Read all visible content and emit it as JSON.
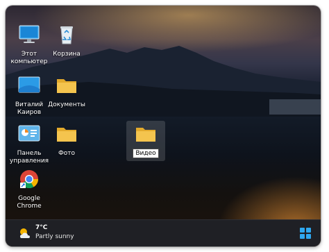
{
  "desktop": {
    "icons": [
      {
        "label": "Этот компьютер",
        "icon": "computer-monitor-icon"
      },
      {
        "label": "Корзина",
        "icon": "recycle-bin-icon"
      },
      {
        "label": "Виталий Каиров",
        "icon": "user-folder-icon"
      },
      {
        "label": "Документы",
        "icon": "folder-icon"
      },
      {
        "label": "Панель управления",
        "icon": "control-panel-icon"
      },
      {
        "label": "Фото",
        "icon": "folder-icon"
      },
      {
        "label": "Google Chrome",
        "icon": "chrome-icon"
      },
      {
        "label": "Видео",
        "icon": "folder-icon",
        "state": "renaming"
      }
    ]
  },
  "taskbar": {
    "weather": {
      "temperature": "7°C",
      "condition": "Partly sunny",
      "icon": "partly-sunny-icon"
    },
    "start_icon": "windows-start-icon"
  },
  "colors": {
    "folder": "#f4c44e",
    "taskbar": "#1f2025",
    "start_accent": "#2fa8f0"
  }
}
